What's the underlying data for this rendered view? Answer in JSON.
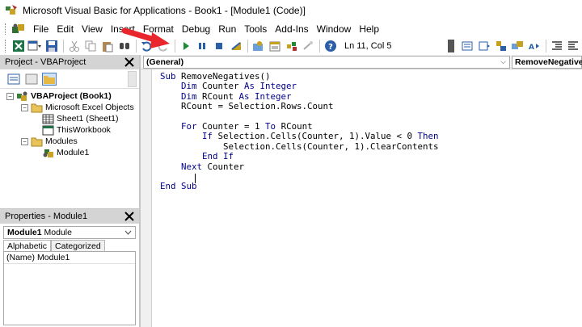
{
  "window": {
    "title": "Microsoft Visual Basic for Applications - Book1 - [Module1 (Code)]"
  },
  "menu": {
    "items": [
      "File",
      "Edit",
      "View",
      "Insert",
      "Format",
      "Debug",
      "Run",
      "Tools",
      "Add-Ins",
      "Window",
      "Help"
    ]
  },
  "toolbar": {
    "cursor_position": "Ln 11, Col 5"
  },
  "project_pane": {
    "title": "Project - VBAProject",
    "tree": {
      "project": "VBAProject (Book1)",
      "excel_objects_folder": "Microsoft Excel Objects",
      "sheet1": "Sheet1 (Sheet1)",
      "thisworkbook": "ThisWorkbook",
      "modules_folder": "Modules",
      "module1": "Module1"
    }
  },
  "properties_pane": {
    "title": "Properties - Module1",
    "object_name": "Module1",
    "object_type": "Module",
    "tabs": [
      "Alphabetic",
      "Categorized"
    ],
    "rows": [
      {
        "name": "(Name)",
        "value": "Module1"
      }
    ]
  },
  "code_window": {
    "object_combo": "(General)",
    "procedure_combo": "RemoveNegatives",
    "lines": [
      {
        "indent": "",
        "parts": [
          {
            "t": "Sub ",
            "kw": true
          },
          {
            "t": "RemoveNegatives()",
            "kw": false
          }
        ]
      },
      {
        "indent": "    ",
        "parts": [
          {
            "t": "Dim ",
            "kw": true
          },
          {
            "t": "Counter ",
            "kw": false
          },
          {
            "t": "As Integer",
            "kw": true
          }
        ]
      },
      {
        "indent": "    ",
        "parts": [
          {
            "t": "Dim ",
            "kw": true
          },
          {
            "t": "RCount ",
            "kw": false
          },
          {
            "t": "As Integer",
            "kw": true
          }
        ]
      },
      {
        "indent": "    ",
        "parts": [
          {
            "t": "RCount = Selection.Rows.Count",
            "kw": false
          }
        ]
      },
      {
        "indent": "",
        "parts": []
      },
      {
        "indent": "    ",
        "parts": [
          {
            "t": "For ",
            "kw": true
          },
          {
            "t": "Counter = 1 ",
            "kw": false
          },
          {
            "t": "To ",
            "kw": true
          },
          {
            "t": "RCount",
            "kw": false
          }
        ]
      },
      {
        "indent": "        ",
        "parts": [
          {
            "t": "If ",
            "kw": true
          },
          {
            "t": "Selection.Cells(Counter, 1).Value < 0 ",
            "kw": false
          },
          {
            "t": "Then",
            "kw": true
          }
        ]
      },
      {
        "indent": "            ",
        "parts": [
          {
            "t": "Selection.Cells(Counter, 1).ClearContents",
            "kw": false
          }
        ]
      },
      {
        "indent": "        ",
        "parts": [
          {
            "t": "End If",
            "kw": true
          }
        ]
      },
      {
        "indent": "    ",
        "parts": [
          {
            "t": "Next ",
            "kw": true
          },
          {
            "t": "Counter",
            "kw": false
          }
        ]
      },
      {
        "indent": "",
        "parts": []
      },
      {
        "indent": "",
        "parts": [
          {
            "t": "End Sub",
            "kw": true
          }
        ]
      }
    ]
  },
  "colors": {
    "keyword": "#00008b",
    "annotation_arrow": "#e8262b",
    "pane_header": "#d4d4d4"
  }
}
